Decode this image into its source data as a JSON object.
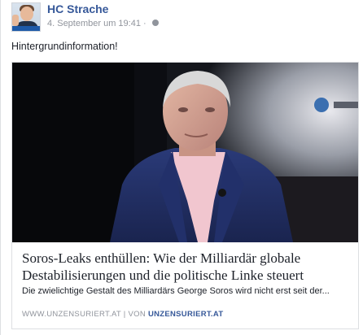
{
  "post": {
    "author_name": "HC Strache",
    "timestamp": "4. September um 19:41",
    "separator": "·",
    "privacy_icon": "globe-icon",
    "status_text": "Hintergrundinformation!",
    "avatar_icon": "profile-photo"
  },
  "link": {
    "image_icon": "article-photo",
    "title": "Soros-Leaks enthüllen: Wie der Milliardär globale Destabilisierungen und die politische Linke steuert",
    "description": "Die zwielichtige Gestalt des Milliardärs George Soros wird nicht erst seit der...",
    "domain": "WWW.UNZENSURIERT.AT",
    "divider": "|",
    "by_prefix": "VON",
    "by_name": "UNZENSURIERT.AT"
  },
  "colors": {
    "link_blue": "#365899",
    "meta_gray": "#90949c",
    "text": "#1d2129",
    "border": "#dddfe2"
  }
}
